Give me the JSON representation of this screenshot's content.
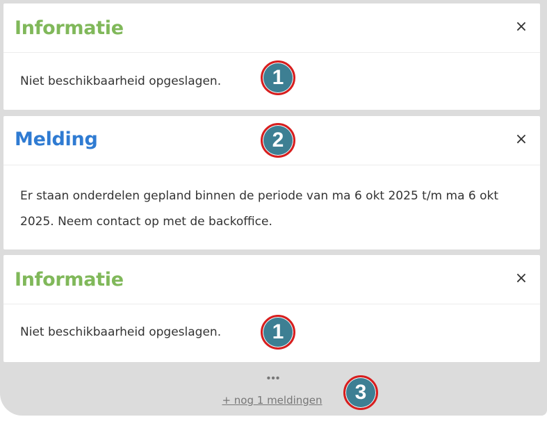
{
  "notifications": [
    {
      "title": "Informatie",
      "message": "Niet beschikbaarheid opgeslagen.",
      "close_icon": "×",
      "badge": "1",
      "color": "#80b85a"
    },
    {
      "title": "Melding",
      "message": "Er staan onderdelen gepland binnen de periode van ma 6 okt 2025 t/m ma 6 okt 2025. Neem contact op met de backoffice.",
      "close_icon": "×",
      "badge": "2",
      "color": "#2f7bd2"
    },
    {
      "title": "Informatie",
      "message": "Niet beschikbaarheid opgeslagen.",
      "close_icon": "×",
      "badge": "1",
      "color": "#80b85a"
    }
  ],
  "footer": {
    "dots": "•••",
    "more_link": "+ nog 1 meldingen",
    "badge": "3"
  },
  "colors": {
    "panel_bg": "#dcdcdc",
    "badge_fill": "#3d7f93",
    "badge_ring": "#d81e1e"
  }
}
